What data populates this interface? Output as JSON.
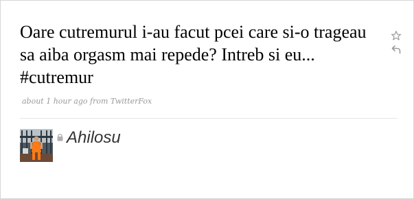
{
  "tweet": {
    "text_before_hashtag": "Oare cutremurul i-au facut pcei care si-o trageau sa aiba orgasm mai repede? Intreb si eu... ",
    "hashtag": "#cutremur",
    "timestamp": "about 1 hour ago",
    "source_prefix": "from",
    "source": "TwitterFox"
  },
  "user": {
    "screen_name": "Ahilosu"
  },
  "icons": {
    "favorite": "star-outline-icon",
    "reply": "reply-arrow-icon",
    "protected": "lock-icon"
  },
  "colors": {
    "meta_text": "#999999",
    "icon_gray": "#9a9a9a",
    "divider": "#e6e6e6",
    "username": "#333333"
  }
}
